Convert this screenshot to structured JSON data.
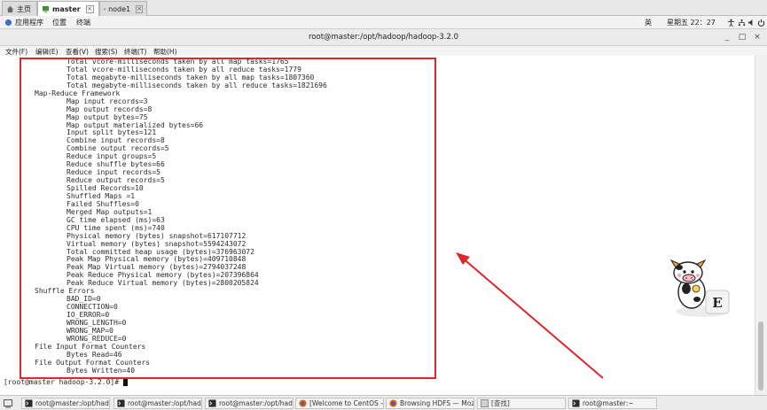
{
  "vm_tabs": [
    {
      "label": "主页",
      "icon": "home-icon"
    },
    {
      "label": "master",
      "icon": "vm-icon",
      "active": true
    },
    {
      "label": "node1",
      "icon": "vm-icon"
    }
  ],
  "gnome_bar": {
    "applications": "应用程序",
    "places": "位置",
    "terminal": "终端",
    "input_method": "英",
    "clock": "星期五 22：27",
    "icons": [
      "accessibility-icon",
      "network-icon",
      "volume-icon",
      "power-icon"
    ]
  },
  "title_bar": {
    "title": "root@master:/opt/hadoop/hadoop-3.2.0",
    "buttons": [
      "minimize-icon",
      "maximize-icon",
      "close-icon"
    ]
  },
  "menu": [
    {
      "label": "文件(F)"
    },
    {
      "label": "编辑(E)"
    },
    {
      "label": "查看(V)"
    },
    {
      "label": "搜索(S)"
    },
    {
      "label": "终端(T)"
    },
    {
      "label": "帮助(H)"
    }
  ],
  "terminal": {
    "lines": [
      {
        "indent": 2,
        "text": "Total vcore-milliseconds taken by all map tasks=1765"
      },
      {
        "indent": 2,
        "text": "Total vcore-milliseconds taken by all reduce tasks=1779"
      },
      {
        "indent": 2,
        "text": "Total megabyte-milliseconds taken by all map tasks=1807360"
      },
      {
        "indent": 2,
        "text": "Total megabyte-milliseconds taken by all reduce tasks=1821696"
      },
      {
        "indent": 1,
        "text": "Map-Reduce Framework"
      },
      {
        "indent": 2,
        "text": "Map input records=3"
      },
      {
        "indent": 2,
        "text": "Map output records=8"
      },
      {
        "indent": 2,
        "text": "Map output bytes=75"
      },
      {
        "indent": 2,
        "text": "Map output materialized bytes=66"
      },
      {
        "indent": 2,
        "text": "Input split bytes=121"
      },
      {
        "indent": 2,
        "text": "Combine input records=8"
      },
      {
        "indent": 2,
        "text": "Combine output records=5"
      },
      {
        "indent": 2,
        "text": "Reduce input groups=5"
      },
      {
        "indent": 2,
        "text": "Reduce shuffle bytes=66"
      },
      {
        "indent": 2,
        "text": "Reduce input records=5"
      },
      {
        "indent": 2,
        "text": "Reduce output records=5"
      },
      {
        "indent": 2,
        "text": "Spilled Records=10"
      },
      {
        "indent": 2,
        "text": "Shuffled Maps =1"
      },
      {
        "indent": 2,
        "text": "Failed Shuffles=0"
      },
      {
        "indent": 2,
        "text": "Merged Map outputs=1"
      },
      {
        "indent": 2,
        "text": "GC time elapsed (ms)=63"
      },
      {
        "indent": 2,
        "text": "CPU time spent (ms)=740"
      },
      {
        "indent": 2,
        "text": "Physical memory (bytes) snapshot=617107712"
      },
      {
        "indent": 2,
        "text": "Virtual memory (bytes) snapshot=5594243072"
      },
      {
        "indent": 2,
        "text": "Total committed heap usage (bytes)=376963072"
      },
      {
        "indent": 2,
        "text": "Peak Map Physical memory (bytes)=409710848"
      },
      {
        "indent": 2,
        "text": "Peak Map Virtual memory (bytes)=2794037248"
      },
      {
        "indent": 2,
        "text": "Peak Reduce Physical memory (bytes)=207396864"
      },
      {
        "indent": 2,
        "text": "Peak Reduce Virtual memory (bytes)=2800205824"
      },
      {
        "indent": 1,
        "text": "Shuffle Errors"
      },
      {
        "indent": 2,
        "text": "BAD_ID=0"
      },
      {
        "indent": 2,
        "text": "CONNECTION=0"
      },
      {
        "indent": 2,
        "text": "IO_ERROR=0"
      },
      {
        "indent": 2,
        "text": "WRONG_LENGTH=0"
      },
      {
        "indent": 2,
        "text": "WRONG_MAP=0"
      },
      {
        "indent": 2,
        "text": "WRONG_REDUCE=0"
      },
      {
        "indent": 1,
        "text": "File Input Format Counters"
      },
      {
        "indent": 2,
        "text": "Bytes Read=46"
      },
      {
        "indent": 1,
        "text": "File Output Format Counters"
      },
      {
        "indent": 2,
        "text": "Bytes Written=40"
      }
    ],
    "prompt": "[root@master hadoop-3.2.0]# "
  },
  "annotation": {
    "highlight_color": "#e0262a",
    "arrow_color": "#e0262a"
  },
  "sticker": {
    "letter": "E"
  },
  "taskbar": [
    {
      "label": "root@master:/opt/hado···",
      "icon": "terminal-icon"
    },
    {
      "label": "root@master:/opt/hado···",
      "icon": "terminal-icon"
    },
    {
      "label": "root@master:/opt/hado···",
      "icon": "terminal-icon"
    },
    {
      "label": "[Welcome to CentOS — ···",
      "icon": "firefox-icon"
    },
    {
      "label": "Browsing HDFS — Mozil···",
      "icon": "firefox-icon"
    },
    {
      "label": "[查找]",
      "icon": "search-window-icon"
    },
    {
      "label": "root@master:~",
      "icon": "terminal-icon"
    }
  ]
}
